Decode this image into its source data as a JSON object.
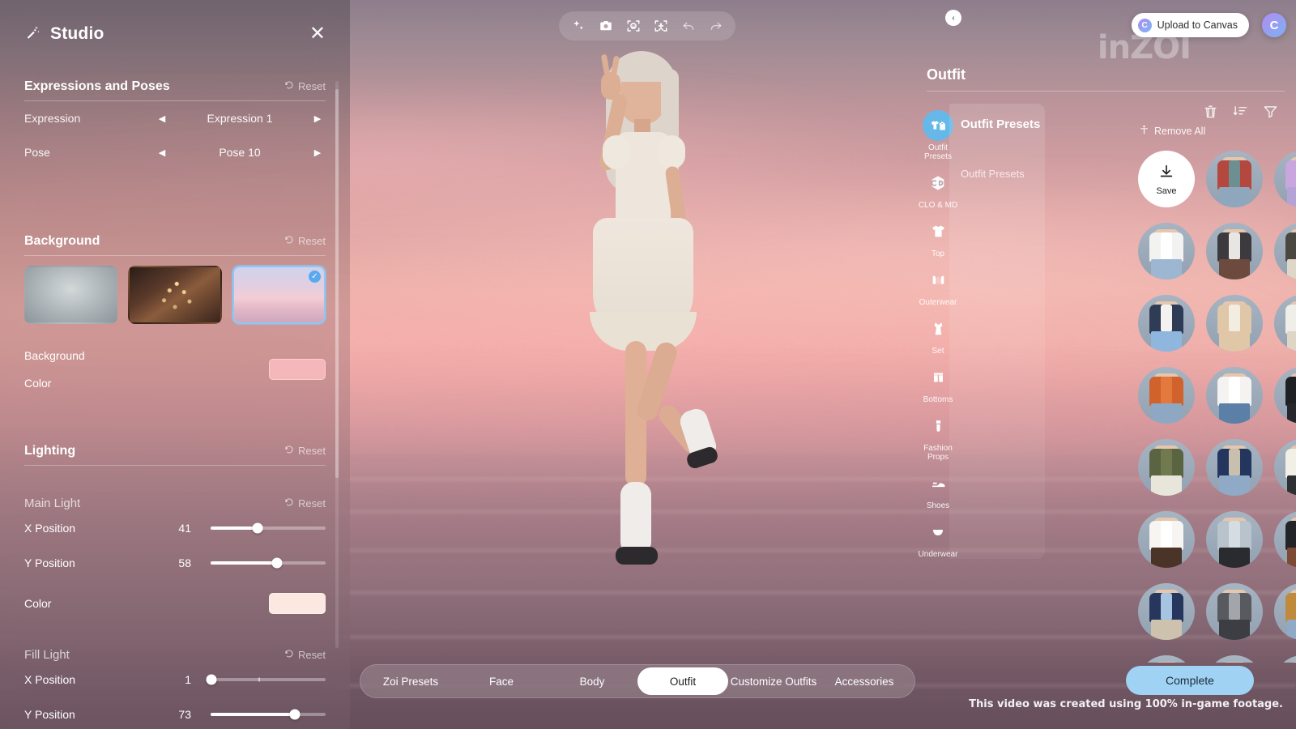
{
  "studio": {
    "title": "Studio",
    "close_label": "✕",
    "wand_icon": "magic-wand-icon",
    "sections": {
      "expressions": {
        "title": "Expressions and Poses",
        "reset_label": "Reset",
        "rows": [
          {
            "label": "Expression",
            "value": "Expression 1",
            "prev": "◀",
            "next": "▶"
          },
          {
            "label": "Pose",
            "value": "Pose 10",
            "prev": "◀",
            "next": "▶"
          }
        ]
      },
      "background": {
        "title": "Background",
        "reset_label": "Reset",
        "thumbs": [
          {
            "name": "studio-backdrop",
            "selected": false
          },
          {
            "name": "room-backdrop",
            "selected": false
          },
          {
            "name": "sky-backdrop",
            "selected": true,
            "check": "✓"
          }
        ],
        "color_label_line1": "Background",
        "color_label_line2": "Color",
        "color_value": "#f6b7bb"
      },
      "lighting": {
        "title": "Lighting",
        "reset_label": "Reset",
        "main_light": {
          "title": "Main Light",
          "reset_label": "Reset",
          "sliders": [
            {
              "label": "X Position",
              "value": 41,
              "percent": 41
            },
            {
              "label": "Y Position",
              "value": 58,
              "percent": 58
            }
          ],
          "color_label": "Color",
          "color_value": "#fbe8e0"
        },
        "fill_light": {
          "title": "Fill Light",
          "reset_label": "Reset",
          "sliders": [
            {
              "label": "X Position",
              "value": 1,
              "percent": 1
            },
            {
              "label": "Y Position",
              "value": 73,
              "percent": 73
            }
          ]
        }
      }
    }
  },
  "toolbar": {
    "items": [
      {
        "icon": "sparkle-icon",
        "label": "Auto Enhance"
      },
      {
        "icon": "camera-icon",
        "label": "Screenshot"
      },
      {
        "icon": "face-focus-icon",
        "label": "Focus Face"
      },
      {
        "icon": "body-focus-icon",
        "label": "Focus Body"
      },
      {
        "icon": "undo-icon",
        "label": "Undo"
      },
      {
        "icon": "redo-icon",
        "label": "Redo"
      }
    ]
  },
  "header": {
    "upload_label": "Upload to Canvas",
    "upload_icon": "canvas-logo-icon",
    "account_icon": "canvas-account-icon",
    "brand": "inZOI"
  },
  "outfit": {
    "title": "Outfit",
    "categories": [
      {
        "name": "Outfit Presets",
        "icon": "outfit-presets-icon",
        "active": true
      },
      {
        "name": "CLO & MD",
        "icon": "clo-md-icon",
        "active": false
      },
      {
        "name": "Top",
        "icon": "top-icon",
        "active": false
      },
      {
        "name": "Outerwear",
        "icon": "outerwear-icon",
        "active": false
      },
      {
        "name": "Set",
        "icon": "set-icon",
        "active": false
      },
      {
        "name": "Bottoms",
        "icon": "bottoms-icon",
        "active": false
      },
      {
        "name": "Fashion Props",
        "icon": "fashion-props-icon",
        "active": false
      },
      {
        "name": "Shoes",
        "icon": "shoes-icon",
        "active": false
      },
      {
        "name": "Underwear",
        "icon": "underwear-icon",
        "active": false
      }
    ],
    "collapse_icon": "chevron-left-icon",
    "subpanel": {
      "title": "Outfit Presets",
      "item": "Outfit Presets"
    },
    "tools": [
      {
        "icon": "trash-icon",
        "label": "Delete"
      },
      {
        "icon": "sort-icon",
        "label": "Sort"
      },
      {
        "icon": "filter-icon",
        "label": "Filter"
      }
    ],
    "remove_all_label": "Remove All",
    "remove_all_icon": "mannequin-icon",
    "save_label": "Save",
    "save_icon": "download-icon",
    "items": [
      {
        "id": 1,
        "kind": "save"
      },
      {
        "id": 2,
        "kind": "outfit",
        "top": "#b4473e",
        "top2": "#6e8f92",
        "bottom": "#8fa7bd"
      },
      {
        "id": 3,
        "kind": "outfit",
        "top": "#c9a6dd",
        "top2": "#d6bce8",
        "bottom": "#b5a2d6"
      },
      {
        "id": 4,
        "kind": "outfit",
        "top": "#f2f2f0",
        "top2": "#ffffff",
        "bottom": "#9db7d2"
      },
      {
        "id": 5,
        "kind": "outfit",
        "top": "#3c3a3e",
        "top2": "#e8e6e3",
        "bottom": "#6d4a3e"
      },
      {
        "id": 6,
        "kind": "outfit",
        "top": "#4a4741",
        "top2": "#b9ae9b",
        "bottom": "#ded7c8"
      },
      {
        "id": 7,
        "kind": "outfit",
        "top": "#2f3c55",
        "top2": "#f3f2f0",
        "bottom": "#8fb6dd"
      },
      {
        "id": 8,
        "kind": "outfit",
        "top": "#e0c7a8",
        "top2": "#f3ece1",
        "bottom": "#e0c7a8"
      },
      {
        "id": 9,
        "kind": "outfit",
        "top": "#f0eee8",
        "top2": "#cfc6b6",
        "bottom": "#ded5c5"
      },
      {
        "id": 10,
        "kind": "outfit",
        "top": "#d2622c",
        "top2": "#e4793d",
        "bottom": "#8ea8c4"
      },
      {
        "id": 11,
        "kind": "outfit",
        "top": "#f4f3f1",
        "top2": "#ffffff",
        "bottom": "#5c7fa8"
      },
      {
        "id": 12,
        "kind": "outfit",
        "top": "#1f2024",
        "top2": "#2d2e33",
        "bottom": "#26272b"
      },
      {
        "id": 13,
        "kind": "outfit",
        "top": "#5b6440",
        "top2": "#717a4e",
        "bottom": "#e8e5da"
      },
      {
        "id": 14,
        "kind": "outfit",
        "top": "#24355e",
        "top2": "#c9bfae",
        "bottom": "#8fa9c6"
      },
      {
        "id": 15,
        "kind": "outfit",
        "top": "#f2efe7",
        "top2": "#ffffff",
        "bottom": "#2e2f33"
      },
      {
        "id": 16,
        "kind": "outfit",
        "top": "#f6f5f2",
        "top2": "#ffffff",
        "bottom": "#4a3428"
      },
      {
        "id": 17,
        "kind": "outfit",
        "top": "#b9c3cc",
        "top2": "#d5dce2",
        "bottom": "#2a2b2f"
      },
      {
        "id": 18,
        "kind": "outfit",
        "top": "#232428",
        "top2": "#35363a",
        "bottom": "#7d4a33"
      },
      {
        "id": 19,
        "kind": "outfit",
        "top": "#27365c",
        "top2": "#a7c4e2",
        "bottom": "#cdc2ad"
      },
      {
        "id": 20,
        "kind": "outfit",
        "top": "#585a60",
        "top2": "#a3a5ac",
        "bottom": "#3c3e44"
      },
      {
        "id": 21,
        "kind": "outfit",
        "top": "#c08a3d",
        "top2": "#d49c4c",
        "bottom": "#8fa9c6"
      },
      {
        "id": 22,
        "kind": "outfit",
        "top": "#2c3f63",
        "top2": "#5a7196",
        "bottom": "#3a4b6b"
      },
      {
        "id": 23,
        "kind": "outfit",
        "top": "#e9e2d2",
        "top2": "#f6f2e8",
        "bottom": "#9db2c9"
      },
      {
        "id": 24,
        "kind": "outfit",
        "top": "#97b0c8",
        "top2": "#c2d2e0",
        "bottom": "#7b93ad"
      }
    ]
  },
  "bottom_nav": {
    "tabs": [
      {
        "label": "Zoi Presets",
        "active": false
      },
      {
        "label": "Face",
        "active": false
      },
      {
        "label": "Body",
        "active": false
      },
      {
        "label": "Outfit",
        "active": true
      },
      {
        "label": "Customize Outfits",
        "active": false
      },
      {
        "label": "Accessories",
        "active": false
      }
    ],
    "complete_label": "Complete"
  },
  "footnote": "This video was created using 100% in-game footage."
}
